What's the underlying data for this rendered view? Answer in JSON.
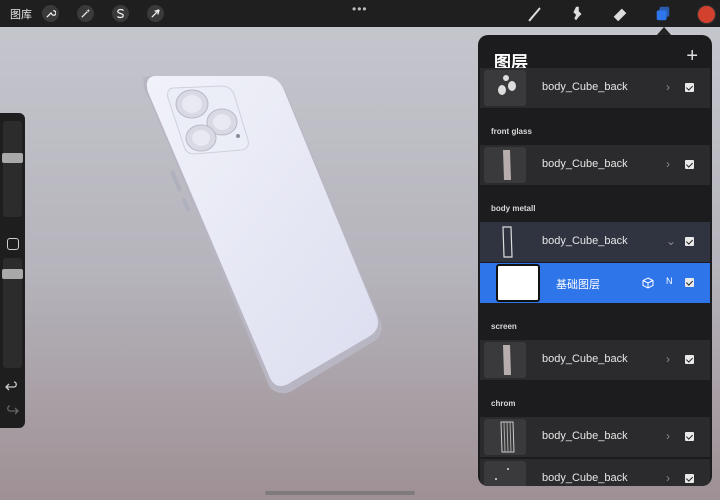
{
  "topbar": {
    "gallery_label": "图库",
    "tools_left": [
      {
        "icon": "wrench-icon"
      },
      {
        "icon": "magic-wand-icon"
      },
      {
        "icon": "selection-s-icon"
      },
      {
        "icon": "transform-arrow-icon"
      }
    ],
    "tools_right": [
      {
        "icon": "brush-icon"
      },
      {
        "icon": "smudge-icon"
      },
      {
        "icon": "eraser-icon"
      },
      {
        "icon": "layers-icon"
      }
    ],
    "current_color": "#d2412e",
    "active_tool_color": "#2f75ea"
  },
  "layers_panel": {
    "title": "图层",
    "add_label": "+",
    "rows": [
      {
        "kind": "layer",
        "name": "body_Cube_back",
        "chevron": "›",
        "visible": true
      },
      {
        "kind": "section",
        "label": "front glass"
      },
      {
        "kind": "layer",
        "name": "body_Cube_back",
        "chevron": "›",
        "visible": true
      },
      {
        "kind": "section",
        "label": "body metall"
      },
      {
        "kind": "group",
        "name": "body_Cube_back",
        "chevron": "⌄",
        "visible": true
      },
      {
        "kind": "active",
        "name": "基础图层",
        "blend": "N",
        "visible": true
      },
      {
        "kind": "section",
        "label": "screen"
      },
      {
        "kind": "layer",
        "name": "body_Cube_back",
        "chevron": "›",
        "visible": true
      },
      {
        "kind": "section",
        "label": "chrom"
      },
      {
        "kind": "layer",
        "name": "body_Cube_back",
        "chevron": "›",
        "visible": true
      },
      {
        "kind": "layer",
        "name": "body_Cube_back",
        "chevron": "›",
        "visible": true
      }
    ]
  }
}
